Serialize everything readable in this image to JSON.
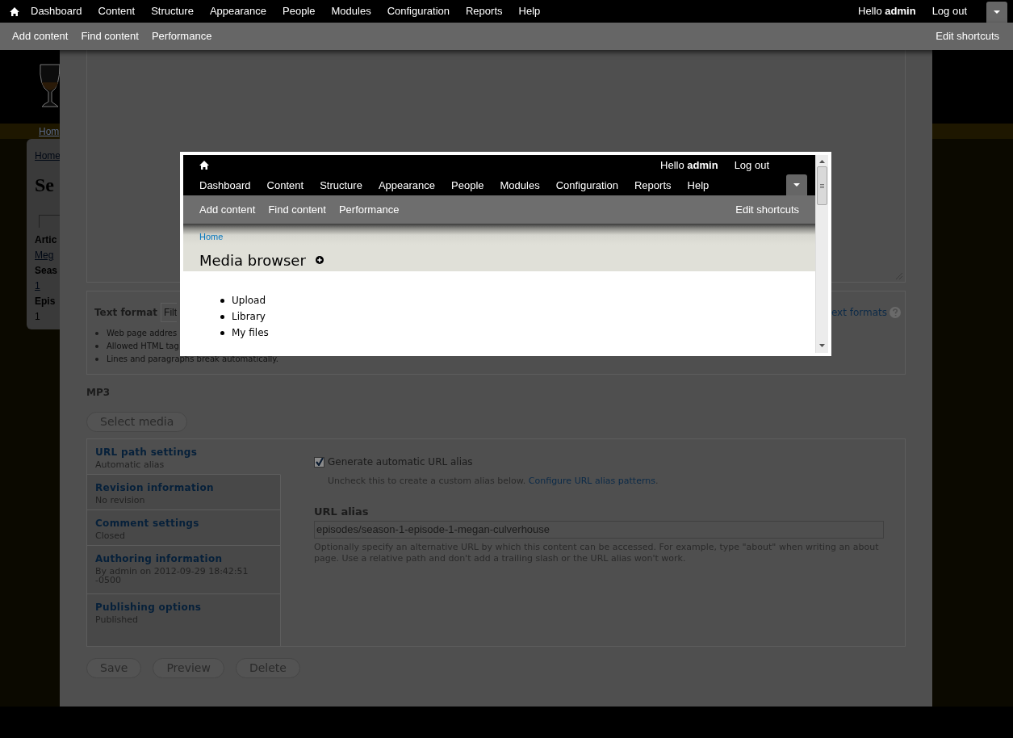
{
  "toolbar": {
    "menu": [
      "Dashboard",
      "Content",
      "Structure",
      "Appearance",
      "People",
      "Modules",
      "Configuration",
      "Reports",
      "Help"
    ],
    "greeting": "Hello **admin**",
    "logout": "Log out"
  },
  "shortcuts": {
    "items": [
      "Add content",
      "Find content",
      "Performance"
    ],
    "edit": "Edit shortcuts"
  },
  "site_background": {
    "breadcrumb_top": "Hom",
    "breadcrumb": "Home",
    "title": "Se",
    "fields": [
      {
        "label": "Artic",
        "value": "Meg",
        "kind": "link"
      },
      {
        "label": "Seas",
        "value": "1",
        "kind": "link"
      },
      {
        "label": "Epis",
        "value": "1",
        "kind": "text"
      }
    ]
  },
  "editor": {
    "text_format": {
      "label": "Text format",
      "select_value": "Filt",
      "tips": [
        "Web page addres",
        "Allowed HTML tag",
        "Lines and paragraphs break automatically."
      ],
      "help_link": "ext formats"
    },
    "mp3": {
      "label": "MP3",
      "button": "Select media"
    },
    "vertical_tabs": [
      {
        "title": "URL path settings",
        "summary": "Automatic alias",
        "selected": true
      },
      {
        "title": "Revision information",
        "summary": "No revision",
        "selected": false
      },
      {
        "title": "Comment settings",
        "summary": "Closed",
        "selected": false
      },
      {
        "title": "Authoring information",
        "summary": "By admin on 2012-09-29 18:42:51 -0500",
        "selected": false
      },
      {
        "title": "Publishing options",
        "summary": "Published",
        "selected": false
      }
    ],
    "url_settings": {
      "checkbox": {
        "label": "Generate automatic URL alias",
        "checked": true
      },
      "description": "Uncheck this to create a custom alias below.",
      "link": "Configure URL alias patterns",
      "description_end": ".",
      "alias_label": "URL alias",
      "alias_value": "episodes/season-1-episode-1-megan-culverhouse",
      "alias_description": "Optionally specify an alternative URL by which this content can be accessed. For example, type \"about\" when writing an about page. Use a relative path and don't add a trailing slash or the URL alias won't work."
    },
    "actions": [
      "Save",
      "Preview",
      "Delete"
    ]
  },
  "modal": {
    "greeting": "Hello **admin**",
    "logout": "Log out",
    "menu": [
      "Dashboard",
      "Content",
      "Structure",
      "Appearance",
      "People",
      "Modules",
      "Configuration",
      "Reports",
      "Help"
    ],
    "shortcuts": [
      "Add content",
      "Find content",
      "Performance"
    ],
    "edit_shortcuts": "Edit shortcuts",
    "breadcrumb": "Home",
    "title": "Media browser",
    "links": [
      "Upload",
      "Library",
      "My files"
    ]
  }
}
